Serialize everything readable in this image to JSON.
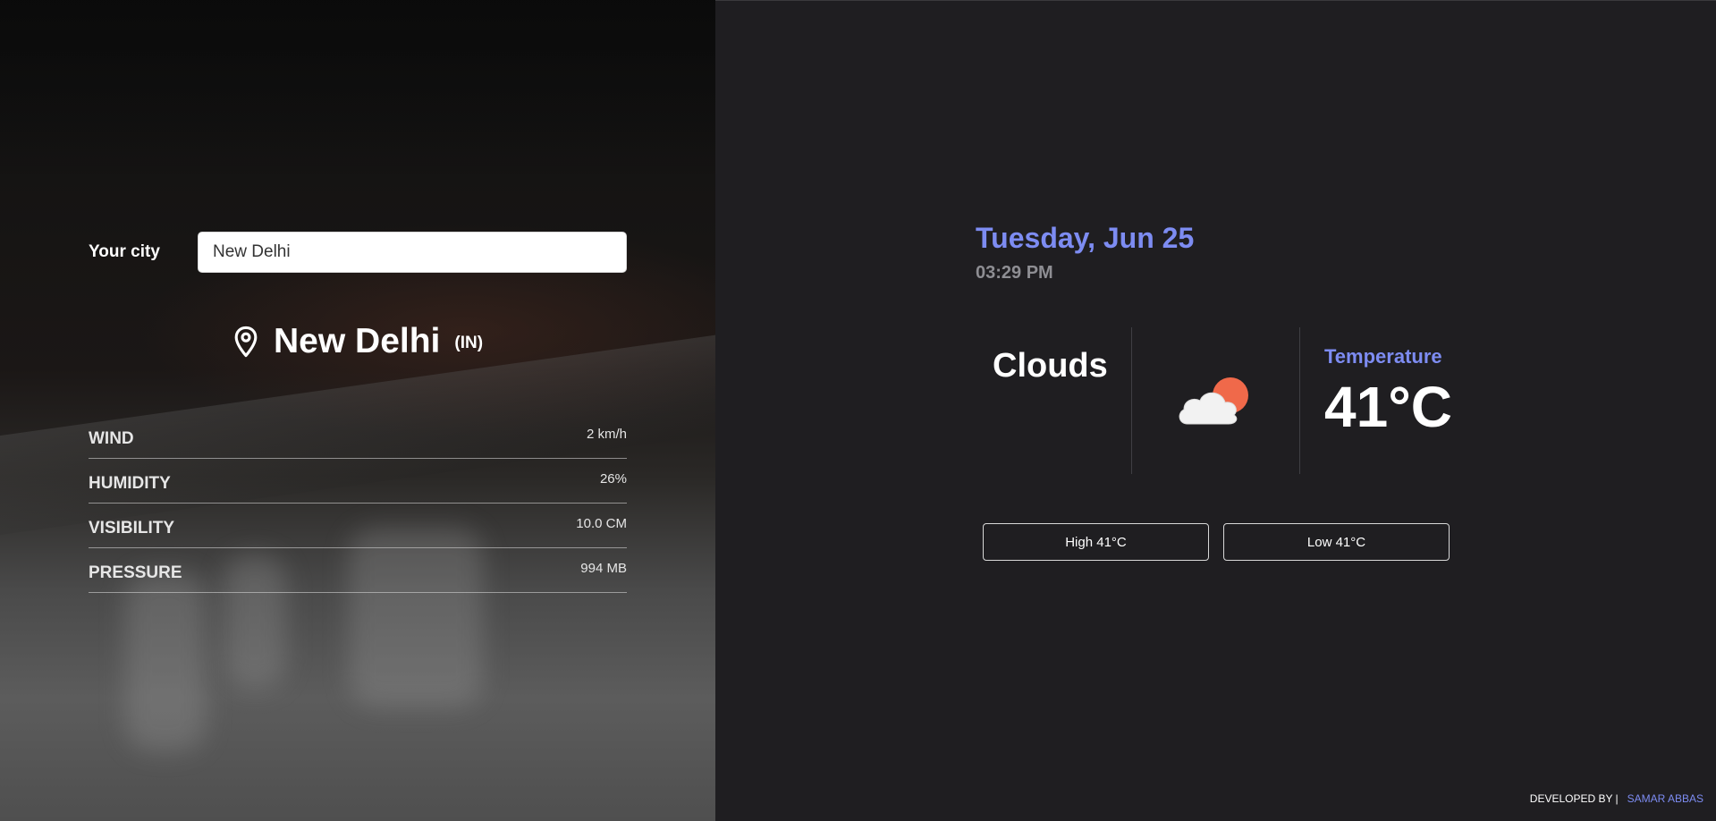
{
  "search": {
    "label": "Your city",
    "value": "New Delhi"
  },
  "location": {
    "city": "New Delhi",
    "country": "(IN)"
  },
  "stats": [
    {
      "label": "WIND",
      "value": "2 km/h"
    },
    {
      "label": "HUMIDITY",
      "value": "26%"
    },
    {
      "label": "VISIBILITY",
      "value": "10.0 CM"
    },
    {
      "label": "PRESSURE",
      "value": "994 MB"
    }
  ],
  "datetime": {
    "date": "Tuesday, Jun 25",
    "time": "03:29 PM"
  },
  "weather": {
    "condition": "Clouds",
    "icon": "cloud-sun-icon",
    "temperature_label": "Temperature",
    "temperature": "41°C"
  },
  "range": {
    "high": "High 41°C",
    "low": "Low 41°C"
  },
  "footer": {
    "developed_by": "DEVELOPED BY",
    "separator": "|",
    "author": "SAMAR ABBAS"
  },
  "colors": {
    "accent": "#7d8cf2",
    "background": "#1f1e21",
    "sun": "#f0694a"
  }
}
